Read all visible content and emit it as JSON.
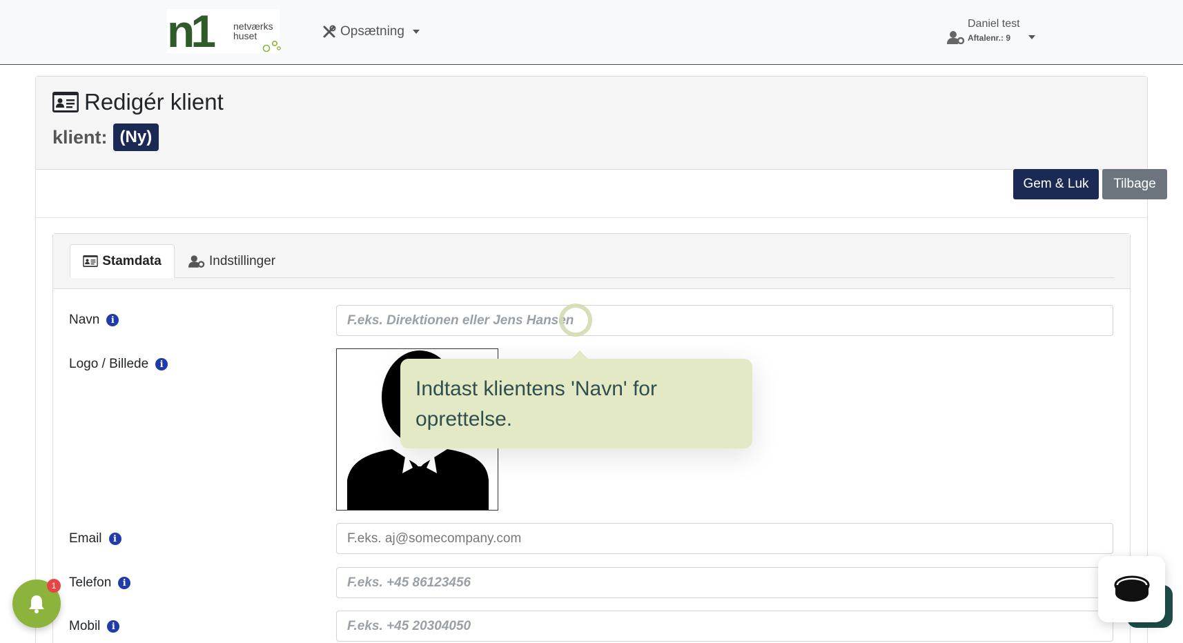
{
  "navbar": {
    "logo": {
      "mark": "n1",
      "line1": "netværks",
      "line2": "huset"
    },
    "setup_label": "Opsætning",
    "user": {
      "name": "Daniel test",
      "aftale_label": "Aftalenr.:",
      "aftale_value": "9"
    }
  },
  "page": {
    "title": "Redigér klient",
    "sub_label": "klient:",
    "badge": "(Ny)"
  },
  "actions": {
    "save_label": "Gem & Luk",
    "back_label": "Tilbage"
  },
  "tabs": [
    {
      "label": "Stamdata",
      "active": true
    },
    {
      "label": "Indstillinger",
      "active": false
    }
  ],
  "form": {
    "navn": {
      "label": "Navn",
      "placeholder": "F.eks. Direktionen eller Jens Hansen",
      "value": ""
    },
    "logo": {
      "label": "Logo / Billede"
    },
    "email": {
      "label": "Email",
      "placeholder": "F.eks. aj@somecompany.com",
      "value": ""
    },
    "telefon": {
      "label": "Telefon",
      "placeholder": "F.eks. +45 86123456",
      "value": ""
    },
    "mobil": {
      "label": "Mobil",
      "placeholder": "F.eks. +45 20304050",
      "value": ""
    }
  },
  "tooltip": {
    "text": "Indtast klientens 'Navn' for oprettelse."
  },
  "notifications": {
    "count": "1"
  },
  "icons": {
    "setup": "tools-icon",
    "user": "user-cog-icon",
    "title": "id-card-icon",
    "info": "info-icon",
    "bell": "bell-icon",
    "chat": "chat-widget-icon"
  },
  "colors": {
    "primary": "#1b2a55",
    "secondary": "#6c757d",
    "info": "#1f3ca8",
    "bell": "#8cb43c",
    "tooltip": "#e3e9c4"
  }
}
